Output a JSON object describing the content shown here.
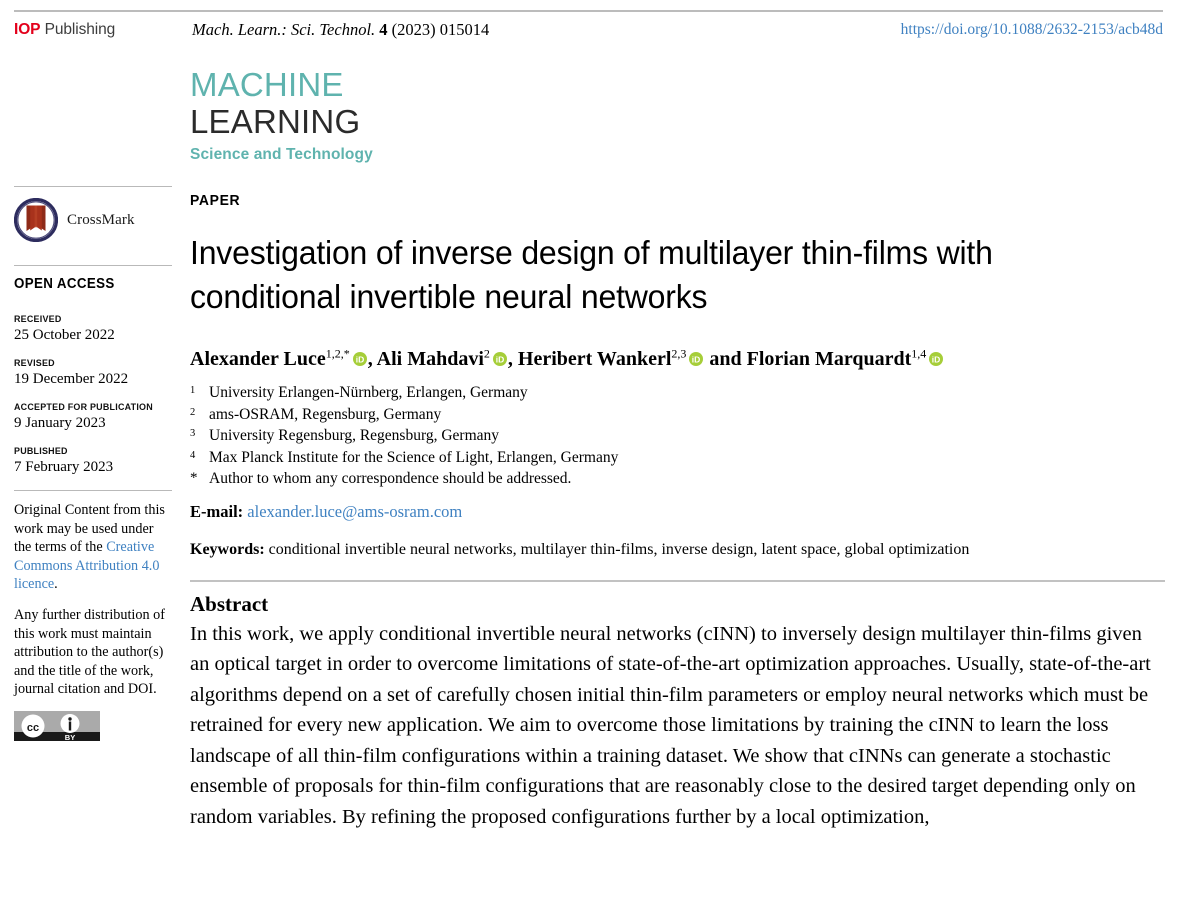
{
  "header": {
    "publisher_mark": "IOP",
    "publisher_word": "Publishing",
    "journal_abbrev": "Mach. Learn.: Sci. Technol.",
    "volume": "4",
    "issue_ref": "(2023) 015014",
    "doi_url": "https://doi.org/10.1088/2632-2153/acb48d"
  },
  "masthead": {
    "line1": "MACHINE",
    "line2": "LEARNING",
    "line3": "Science and Technology",
    "accent_color": "#5fb3ae"
  },
  "sidebar": {
    "crossmark_label": "CrossMark",
    "open_access_label": "OPEN ACCESS",
    "dates": [
      {
        "key": "RECEIVED",
        "value": "25 October 2022"
      },
      {
        "key": "REVISED",
        "value": "19 December 2022"
      },
      {
        "key": "ACCEPTED FOR PUBLICATION",
        "value": "9 January 2023"
      },
      {
        "key": "PUBLISHED",
        "value": "7 February 2023"
      }
    ],
    "license_p1_before": "Original Content from this work may be used under the terms of the ",
    "license_link": "Creative Commons Attribution 4.0 licence",
    "license_p1_after": ".",
    "license_p2": "Any further distribution of this work must maintain attribution to the author(s) and the title of the work, journal citation and DOI.",
    "cc_badge_text": "BY",
    "cc_badge_cc": "cc"
  },
  "article": {
    "kicker": "PAPER",
    "title": "Investigation of inverse design of multilayer thin-films with conditional invertible neural networks",
    "authors": [
      {
        "name": "Alexander Luce",
        "sup": "1,2,*",
        "orcid": true,
        "sep": ", "
      },
      {
        "name": "Ali Mahdavi",
        "sup": "2",
        "orcid": true,
        "sep": ", "
      },
      {
        "name": "Heribert Wankerl",
        "sup": "2,3",
        "orcid": true,
        "sep": " and "
      },
      {
        "name": "Florian Marquardt",
        "sup": "1,4",
        "orcid": true,
        "sep": ""
      }
    ],
    "affiliations": [
      {
        "num": "1",
        "text": "University Erlangen-Nürnberg, Erlangen, Germany"
      },
      {
        "num": "2",
        "text": "ams-OSRAM, Regensburg, Germany"
      },
      {
        "num": "3",
        "text": "University Regensburg, Regensburg, Germany"
      },
      {
        "num": "4",
        "text": "Max Planck Institute for the Science of Light, Erlangen, Germany"
      },
      {
        "num": "*",
        "text": "Author to whom any correspondence should be addressed."
      }
    ],
    "email_label": "E-mail:",
    "email": "alexander.luce@ams-osram.com",
    "keywords_label": "Keywords:",
    "keywords": "conditional invertible neural networks, multilayer thin-films, inverse design, latent space, global optimization",
    "abstract_heading": "Abstract",
    "abstract_text": "In this work, we apply conditional invertible neural networks (cINN) to inversely design multilayer thin-films given an optical target in order to overcome limitations of state-of-the-art optimization approaches. Usually, state-of-the-art algorithms depend on a set of carefully chosen initial thin-film parameters or employ neural networks which must be retrained for every new application. We aim to overcome those limitations by training the cINN to learn the loss landscape of all thin-film configurations within a training dataset. We show that cINNs can generate a stochastic ensemble of proposals for thin-film configurations that are reasonably close to the desired target depending only on random variables. By refining the proposed configurations further by a local optimization,"
  },
  "colors": {
    "link_blue": "#3f81c1",
    "iop_red": "#e3001b",
    "orcid_green": "#a6ce39",
    "rule_gray": "#bcbcbc"
  }
}
